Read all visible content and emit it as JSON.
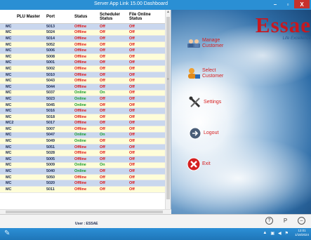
{
  "window": {
    "title": "Server App Link 15.00 Dashboard",
    "minimize_glyph": "–",
    "maximize_glyph": "▫",
    "close_glyph": "X"
  },
  "table": {
    "columns": {
      "plu": "PLU Master",
      "port": "Port",
      "status": "Status",
      "scheduler_1": "Scheduler",
      "scheduler_2": "Status",
      "file_1": "File Online",
      "file_2": "Status"
    },
    "rows": [
      {
        "plu": "MC",
        "port": "5013",
        "status": "Offline",
        "sched": "Off",
        "file": "Off"
      },
      {
        "plu": "MC",
        "port": "5024",
        "status": "Offline",
        "sched": "Off",
        "file": "Off"
      },
      {
        "plu": "MC",
        "port": "5014",
        "status": "Offline",
        "sched": "Off",
        "file": "Off"
      },
      {
        "plu": "MC",
        "port": "5052",
        "status": "Offline",
        "sched": "Off",
        "file": "Off"
      },
      {
        "plu": "MC",
        "port": "5006",
        "status": "Offline",
        "sched": "Off",
        "file": "Off"
      },
      {
        "plu": "MC",
        "port": "5008",
        "status": "Offline",
        "sched": "Off",
        "file": "Off"
      },
      {
        "plu": "MC",
        "port": "5001",
        "status": "Offline",
        "sched": "Off",
        "file": "Off"
      },
      {
        "plu": "MC",
        "port": "5002",
        "status": "Offline",
        "sched": "Off",
        "file": "Off"
      },
      {
        "plu": "MC",
        "port": "5010",
        "status": "Offline",
        "sched": "Off",
        "file": "Off"
      },
      {
        "plu": "MC",
        "port": "5043",
        "status": "Offline",
        "sched": "Off",
        "file": "Off"
      },
      {
        "plu": "MC",
        "port": "5044",
        "status": "Offline",
        "sched": "Off",
        "file": "Off"
      },
      {
        "plu": "MC",
        "port": "5037",
        "status": "Online",
        "sched": "On",
        "file": "Off"
      },
      {
        "plu": "MC",
        "port": "5023",
        "status": "Online",
        "sched": "Off",
        "file": "Off"
      },
      {
        "plu": "MC",
        "port": "5045",
        "status": "Online",
        "sched": "Off",
        "file": "Off"
      },
      {
        "plu": "MC",
        "port": "5016",
        "status": "Offline",
        "sched": "Off",
        "file": "Off"
      },
      {
        "plu": "MC",
        "port": "5018",
        "status": "Offline",
        "sched": "Off",
        "file": "Off"
      },
      {
        "plu": "MC2",
        "port": "5017",
        "status": "Offline",
        "sched": "Off",
        "file": "Off"
      },
      {
        "plu": "MC",
        "port": "5007",
        "status": "Offline",
        "sched": "Off",
        "file": "Off"
      },
      {
        "plu": "MC",
        "port": "5047",
        "status": "Online",
        "sched": "On",
        "file": "Off"
      },
      {
        "plu": "MC",
        "port": "5049",
        "status": "Online",
        "sched": "Off",
        "file": "Off"
      },
      {
        "plu": "MC",
        "port": "5051",
        "status": "Offline",
        "sched": "Off",
        "file": "Off"
      },
      {
        "plu": "MC",
        "port": "5028",
        "status": "Offline",
        "sched": "Off",
        "file": "Off"
      },
      {
        "plu": "MC",
        "port": "5005",
        "status": "Offline",
        "sched": "Off",
        "file": "Off"
      },
      {
        "plu": "MC",
        "port": "5009",
        "status": "Online",
        "sched": "On",
        "file": "Off"
      },
      {
        "plu": "MC",
        "port": "5040",
        "status": "Online",
        "sched": "Off",
        "file": "Off"
      },
      {
        "plu": "MC",
        "port": "5050",
        "status": "Offline",
        "sched": "Off",
        "file": "Off"
      },
      {
        "plu": "MC",
        "port": "5020",
        "status": "Offline",
        "sched": "Off",
        "file": "Off"
      },
      {
        "plu": "MC",
        "port": "5011",
        "status": "Offline",
        "sched": "Off",
        "file": "Off"
      }
    ]
  },
  "brand": {
    "name": "Essae",
    "tagline": "Life Excellence"
  },
  "menu": {
    "manage": {
      "label": "Manage Customer",
      "icon": "users-icon"
    },
    "select": {
      "label": "Select Customer",
      "icon": "select-user-icon"
    },
    "settings": {
      "label": "Settings",
      "icon": "tools-icon"
    },
    "logout": {
      "label": "Logout",
      "icon": "logout-icon"
    },
    "exit": {
      "label": "Exit",
      "icon": "exit-icon"
    }
  },
  "statusbar": {
    "user_text": "User : ESSAE",
    "help_glyph": "?",
    "p_glyph": "P",
    "minimize_glyph": "–"
  },
  "taskbar": {
    "clock_time": "12:01",
    "clock_date": "1/18/2024"
  },
  "colors": {
    "titlebar": "#2a8fd4",
    "offline_red": "#e01010",
    "online_green": "#129a2a",
    "row_blue": "#c9d7ee",
    "row_yellow": "#fefdd8",
    "brand_red": "#c7181f"
  }
}
